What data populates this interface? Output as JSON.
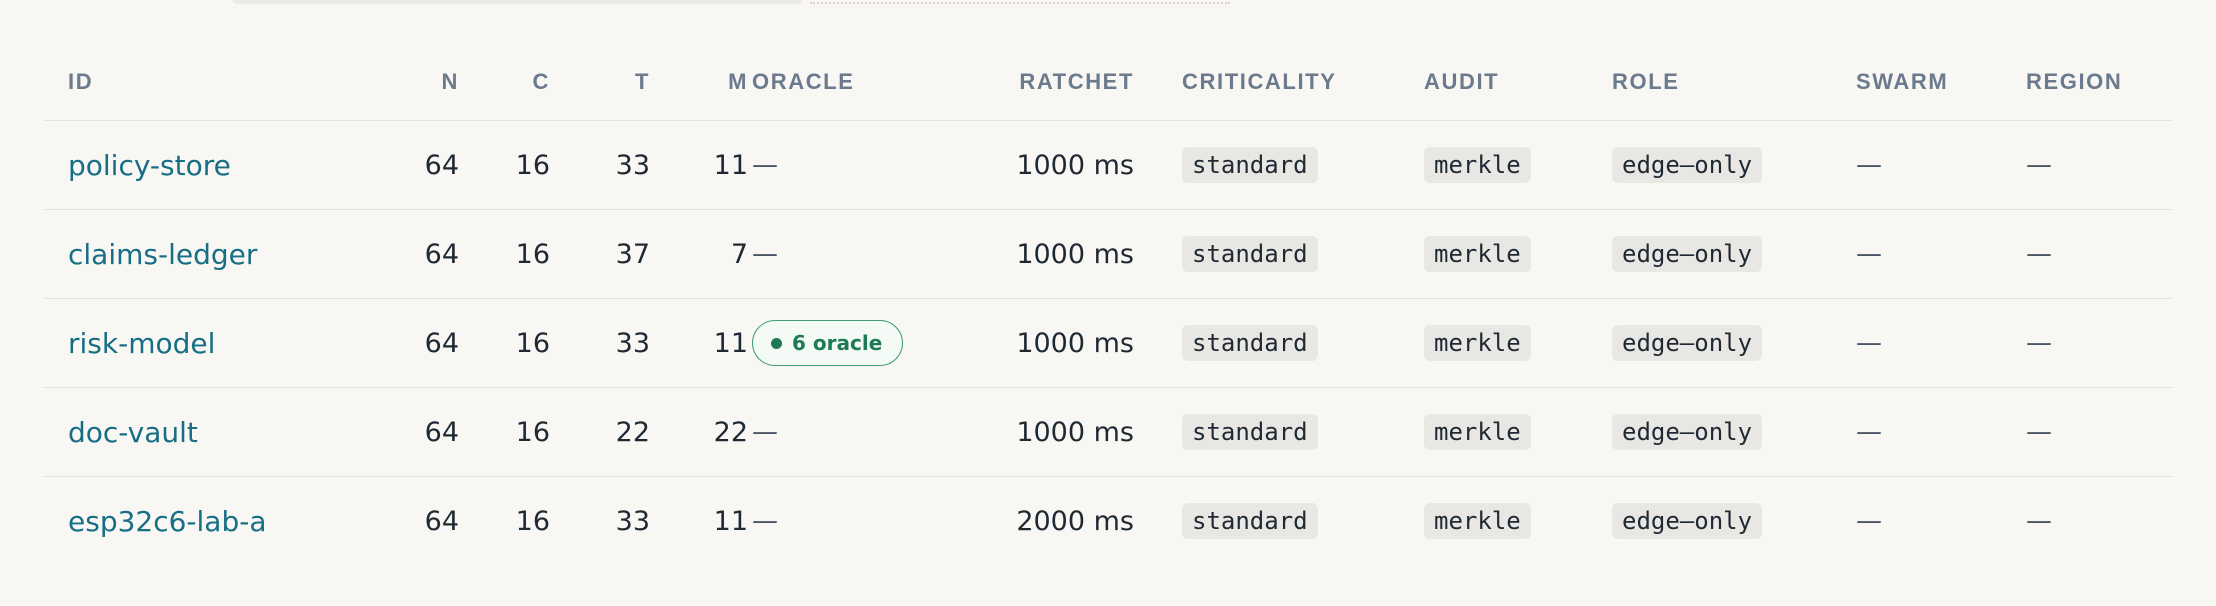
{
  "table": {
    "headers": {
      "id": "ID",
      "n": "N",
      "c": "C",
      "t": "T",
      "m": "M",
      "oracle": "ORACLE",
      "ratchet": "RATCHET",
      "criticality": "CRITICALITY",
      "audit": "AUDIT",
      "role": "ROLE",
      "swarm": "SWARM",
      "region": "REGION"
    },
    "rows": [
      {
        "id": "policy-store",
        "n": "64",
        "c": "16",
        "t": "33",
        "m": "11",
        "oracle": "—",
        "ratchet": "1000 ms",
        "criticality": "standard",
        "audit": "merkle",
        "role": "edge–only",
        "swarm": "—",
        "region": "—"
      },
      {
        "id": "claims-ledger",
        "n": "64",
        "c": "16",
        "t": "37",
        "m": "7",
        "oracle": "—",
        "ratchet": "1000 ms",
        "criticality": "standard",
        "audit": "merkle",
        "role": "edge–only",
        "swarm": "—",
        "region": "—"
      },
      {
        "id": "risk-model",
        "n": "64",
        "c": "16",
        "t": "33",
        "m": "11",
        "oracle": "6 oracle",
        "ratchet": "1000 ms",
        "criticality": "standard",
        "audit": "merkle",
        "role": "edge–only",
        "swarm": "—",
        "region": "—"
      },
      {
        "id": "doc-vault",
        "n": "64",
        "c": "16",
        "t": "22",
        "m": "22",
        "oracle": "—",
        "ratchet": "1000 ms",
        "criticality": "standard",
        "audit": "merkle",
        "role": "edge–only",
        "swarm": "—",
        "region": "—"
      },
      {
        "id": "esp32c6-lab-a",
        "n": "64",
        "c": "16",
        "t": "33",
        "m": "11",
        "oracle": "—",
        "ratchet": "2000 ms",
        "criticality": "standard",
        "audit": "merkle",
        "role": "edge–only",
        "swarm": "—",
        "region": "—"
      }
    ]
  },
  "colors": {
    "background": "#f8f7f4",
    "link": "#176e85",
    "header_text": "#6b7a8c",
    "oracle_accent": "#1d7a52",
    "chip_bg": "#e9e7e4",
    "divider": "#e4e2de"
  },
  "icons": {
    "oracle_status": "status-dot-icon"
  }
}
